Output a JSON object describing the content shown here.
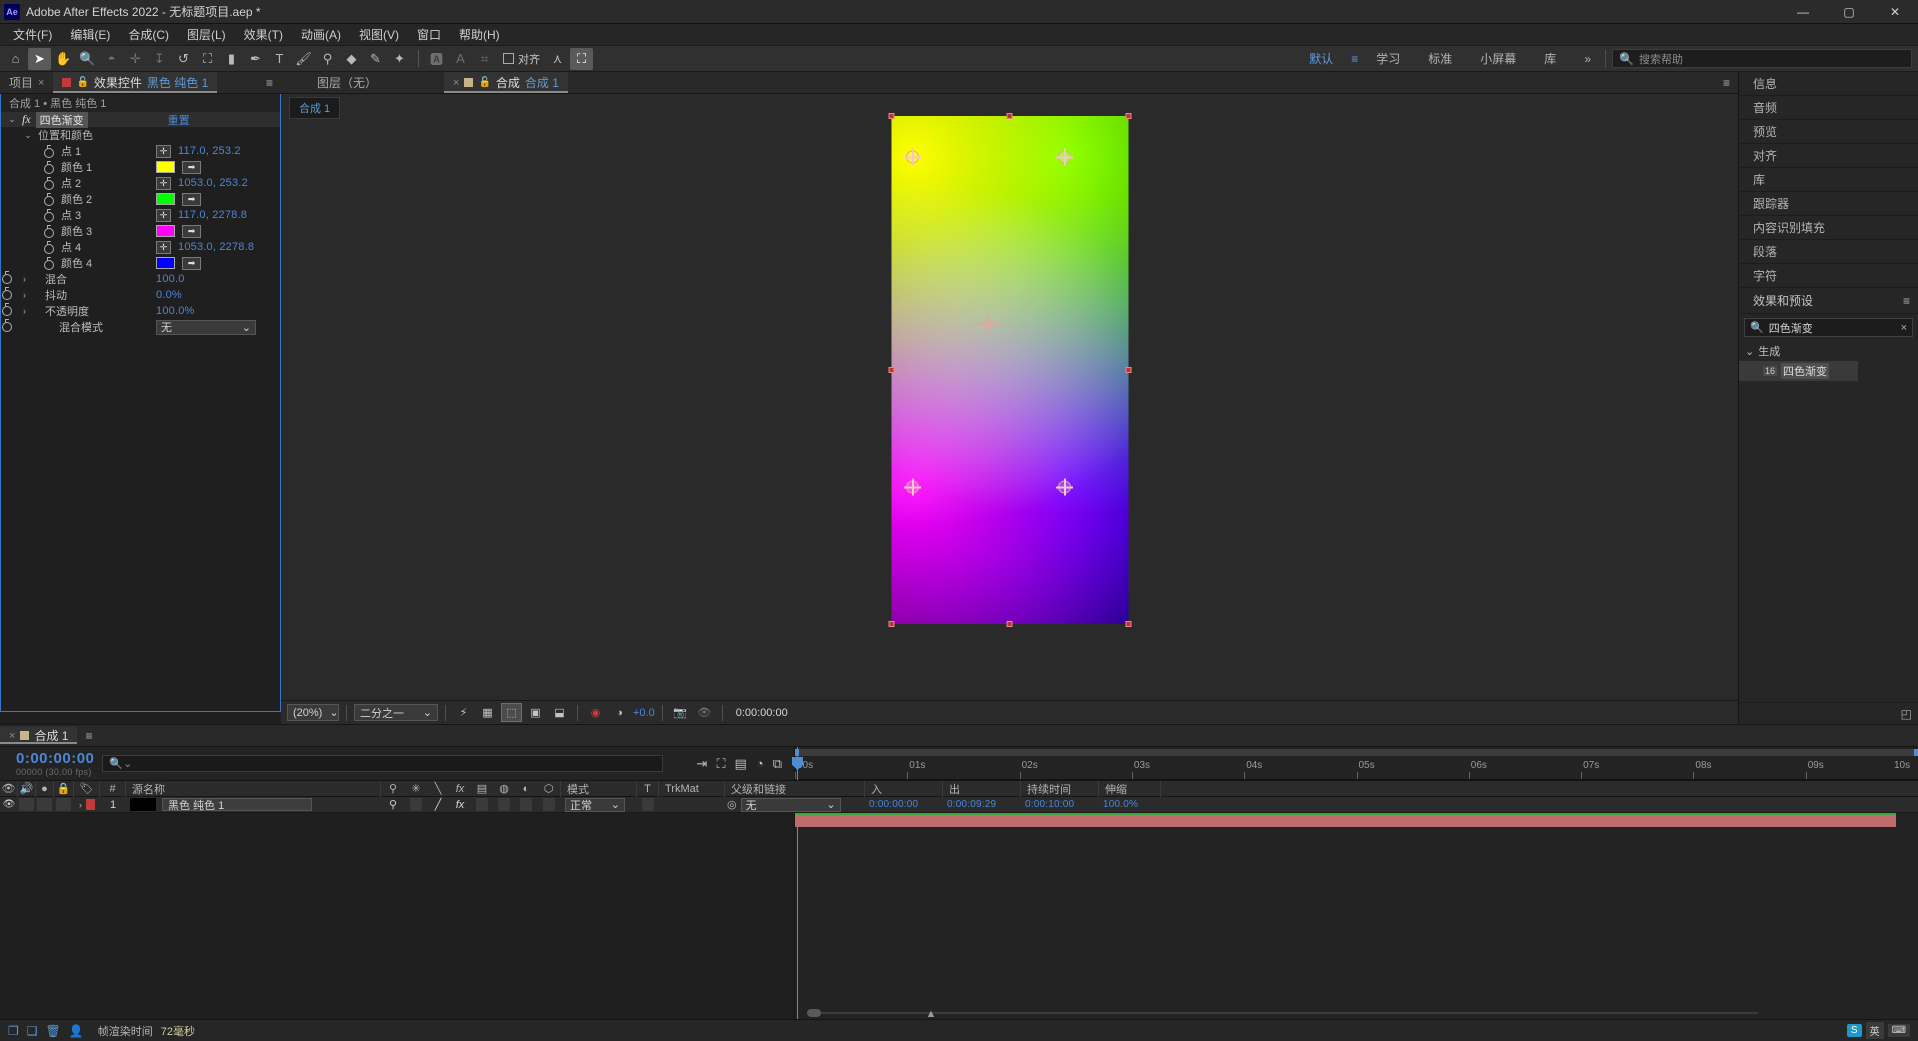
{
  "window": {
    "title": "Adobe After Effects 2022 - 无标题项目.aep *",
    "logo": "Ae",
    "minimize": "—",
    "maximize": "▢",
    "close": "✕"
  },
  "menubar": [
    "文件(F)",
    "编辑(E)",
    "合成(C)",
    "图层(L)",
    "效果(T)",
    "动画(A)",
    "视图(V)",
    "窗口",
    "帮助(H)"
  ],
  "toolbar": {
    "tools": [
      {
        "name": "home-icon",
        "glyph": "⌂",
        "active": false,
        "dim": false
      },
      {
        "name": "selection-tool",
        "glyph": "➤",
        "active": true,
        "dim": false
      },
      {
        "name": "hand-tool",
        "glyph": "✋",
        "active": false,
        "dim": false
      },
      {
        "name": "zoom-tool",
        "glyph": "🔍",
        "active": false,
        "dim": false
      },
      {
        "name": "orbit-tool",
        "glyph": "◓",
        "active": false,
        "dim": true
      },
      {
        "name": "pan-tool",
        "glyph": "✛",
        "active": false,
        "dim": true
      },
      {
        "name": "dolly-tool",
        "glyph": "↧",
        "active": false,
        "dim": true
      },
      {
        "name": "rotation-tool",
        "glyph": "↺",
        "active": false,
        "dim": false
      },
      {
        "name": "anchor-point-tool",
        "glyph": "⛶",
        "active": false,
        "dim": false
      },
      {
        "name": "rectangle-tool",
        "glyph": "▮",
        "active": false,
        "dim": false
      },
      {
        "name": "pen-tool",
        "glyph": "✒",
        "active": false,
        "dim": false
      },
      {
        "name": "type-tool",
        "glyph": "T",
        "active": false,
        "dim": false
      },
      {
        "name": "brush-tool",
        "glyph": "🖌",
        "active": false,
        "dim": false
      },
      {
        "name": "clone-stamp-tool",
        "glyph": "⚲",
        "active": false,
        "dim": false
      },
      {
        "name": "eraser-tool",
        "glyph": "◆",
        "active": false,
        "dim": false
      },
      {
        "name": "roto-brush-tool",
        "glyph": "✎",
        "active": false,
        "dim": false
      },
      {
        "name": "puppet-pin-tool",
        "glyph": "✦",
        "active": false,
        "dim": false
      }
    ],
    "tools2": [
      {
        "name": "puppet-starch-tool",
        "glyph": "🅰",
        "active": false,
        "dim": true
      },
      {
        "name": "puppet-overlap-tool",
        "glyph": "A",
        "active": false,
        "dim": true
      },
      {
        "name": "puppet-bend-tool",
        "glyph": "⌗",
        "active": false,
        "dim": true
      }
    ],
    "snap_label": "对齐",
    "tools3": [
      {
        "name": "pin-tool",
        "glyph": "⋏",
        "active": false,
        "dim": false
      },
      {
        "name": "region-of-interest",
        "glyph": "⛶",
        "active": true,
        "dim": false
      }
    ]
  },
  "workspace": {
    "items": [
      {
        "label": "默认",
        "selected": true
      },
      {
        "label": "学习",
        "selected": false
      },
      {
        "label": "标准",
        "selected": false
      },
      {
        "label": "小屏幕",
        "selected": false
      },
      {
        "label": "库",
        "selected": false
      }
    ],
    "overflow": "»",
    "help_placeholder": "搜索帮助",
    "help_icon": "search-icon"
  },
  "effect_controls": {
    "tabs": [
      {
        "label": "项目",
        "active": false,
        "close": "×"
      },
      {
        "label_prefix": "效果控件",
        "label_highlight": "黑色 纯色 1",
        "active": true
      }
    ],
    "panel_menu": "≡",
    "breadcrumb": "合成 1 • 黑色 纯色 1",
    "effect_name": "四色渐变",
    "reset_label": "重置",
    "group_label": "位置和颜色",
    "properties": [
      {
        "name": "点 1",
        "type": "point",
        "value": "117.0, 253.2"
      },
      {
        "name": "颜色 1",
        "type": "color",
        "value": "#FFFF00"
      },
      {
        "name": "点 2",
        "type": "point",
        "value": "1053.0, 253.2"
      },
      {
        "name": "颜色 2",
        "type": "color",
        "value": "#00FF00"
      },
      {
        "name": "点 3",
        "type": "point",
        "value": "117.0, 2278.8"
      },
      {
        "name": "颜色 3",
        "type": "color",
        "value": "#FF00FF"
      },
      {
        "name": "点 4",
        "type": "point",
        "value": "1053.0, 2278.8"
      },
      {
        "name": "颜色 4",
        "type": "color",
        "value": "#0000FF"
      }
    ],
    "sliders": [
      {
        "name": "混合",
        "value": "100.0"
      },
      {
        "name": "抖动",
        "value": "0.0%"
      },
      {
        "name": "不透明度",
        "value": "100.0%"
      }
    ],
    "blend_mode": {
      "name": "混合模式",
      "value": "无",
      "caret": "⌄"
    }
  },
  "composition_viewer": {
    "tabs": [
      {
        "label": "图层（无）",
        "active": false
      },
      {
        "label_prefix": "合成",
        "label_highlight": "合成 1",
        "active": true,
        "close": "×"
      }
    ],
    "panel_menu": "≡",
    "sub_tab": "合成 1",
    "toolbar": {
      "zoom": "(20%)",
      "resolution": "二分之一",
      "exposure": "+0.0",
      "timecode": "0:00:00:00",
      "buttons": [
        {
          "name": "fast-preview-icon",
          "glyph": "⚡"
        },
        {
          "name": "transparency-grid-icon",
          "glyph": "▦"
        },
        {
          "name": "region-of-interest-icon",
          "glyph": "⬚",
          "on": true
        },
        {
          "name": "mask-view-icon",
          "glyph": "▣"
        },
        {
          "name": "timeline-toggle-icon",
          "glyph": "⬓"
        },
        {
          "name": "channel-rgb-icon",
          "glyph": "◉"
        },
        {
          "name": "exposure-icon",
          "glyph": "◐"
        },
        {
          "name": "snapshot-icon",
          "glyph": "📷"
        },
        {
          "name": "show-snapshot-icon",
          "glyph": "👁"
        }
      ]
    }
  },
  "gradient": {
    "color1": "#FFFF00",
    "color2": "#00FF00",
    "color3": "#FF00FF",
    "color4": "#0000FF"
  },
  "right_sidebar": {
    "items": [
      "信息",
      "音频",
      "预览",
      "对齐",
      "库",
      "跟踪器",
      "内容识别填充",
      "段落",
      "字符"
    ],
    "effects_panel": {
      "title": "效果和预设",
      "menu": "≡",
      "search_value": "四色渐变",
      "search_icon": "search-icon",
      "clear_icon": "×",
      "tree": {
        "category": "生成",
        "caret": "⌄",
        "item": "四色渐变",
        "badge": "16"
      }
    }
  },
  "timeline": {
    "tab_label": "合成 1",
    "tab_close": "×",
    "panel_menu": "≡",
    "current_time": "0:00:00:00",
    "frame_info": "00000 (30.00 fps)",
    "search_icon": "search-icon",
    "columns": [
      "源名称",
      "模式",
      "T",
      "TrkMat",
      "父级和链接",
      "入",
      "出",
      "持续时间",
      "伸缩"
    ],
    "header_icons": [
      "眼睛",
      "音频",
      "独奏",
      "锁定",
      "标签",
      "#"
    ],
    "layers": [
      {
        "index": "1",
        "source_name": "黑色 纯色 1",
        "mode": "正常",
        "trkmat": "",
        "parent": "无",
        "in": "0:00:00:00",
        "out": "0:00:09:29",
        "duration": "0:00:10:00",
        "stretch": "100.0%",
        "color": "#c23a3a"
      }
    ],
    "ruler_labels": [
      "00s",
      "01s",
      "02s",
      "03s",
      "04s",
      "05s",
      "06s",
      "07s",
      "08s",
      "09s",
      "10s"
    ]
  },
  "statusbar": {
    "render_label": "帧渲染时间",
    "render_value": "72毫秒",
    "icons": [
      "新建合成",
      "新建文件夹",
      "删除",
      "用户"
    ],
    "tray": {
      "ime": "英",
      "box": "S"
    }
  }
}
